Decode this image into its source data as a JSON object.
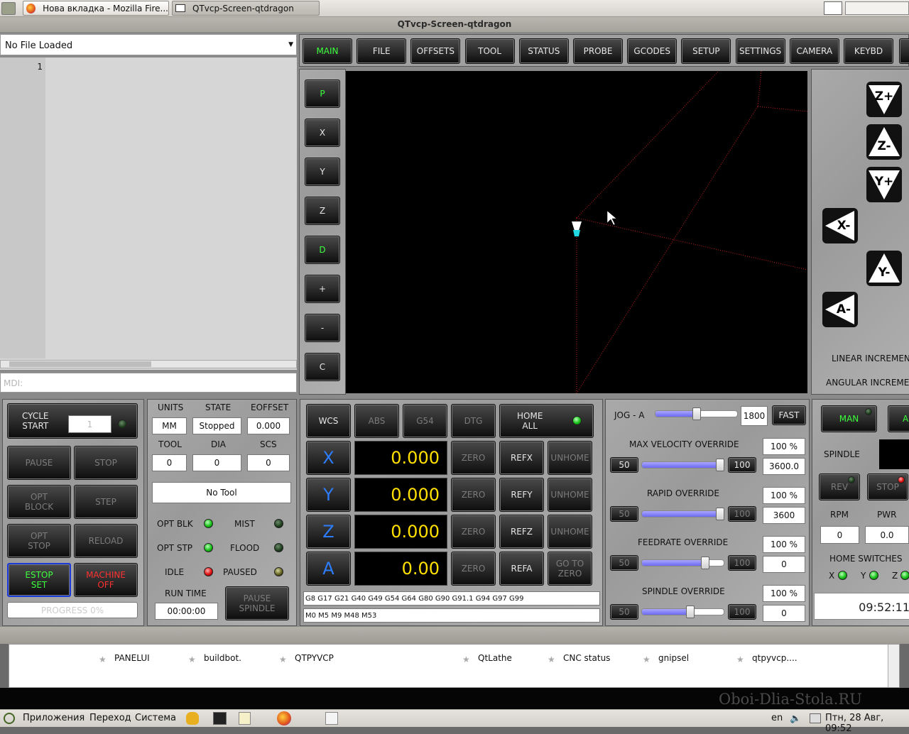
{
  "taskbar": {
    "firefox_tab": "Нова вкладка - Mozilla Fire...",
    "qtvcp_tab": "QTvcp-Screen-qtdragon"
  },
  "window": {
    "title": "QTvcp-Screen-qtdragon"
  },
  "file": {
    "current": "No File Loaded",
    "line_number": "1",
    "mdi_placeholder": "MDI:"
  },
  "tabs": [
    "MAIN",
    "FILE",
    "OFFSETS",
    "TOOL",
    "STATUS",
    "PROBE",
    "GCODES",
    "SETUP",
    "SETTINGS",
    "CAMERA",
    "KEYBD"
  ],
  "view_buttons": [
    "P",
    "X",
    "Y",
    "Z",
    "D",
    "+",
    "-",
    "C"
  ],
  "jog_buttons": [
    "Z+",
    "Z-",
    "Y+",
    "X-",
    "Y-",
    "A-"
  ],
  "increments": {
    "linear": "LINEAR INCREMEN",
    "angular": "ANGULAR INCREMEN"
  },
  "cycle": {
    "cycle_start": "CYCLE\nSTART",
    "cycle_count": "1",
    "pause": "PAUSE",
    "stop": "STOP",
    "opt_block": "OPT\nBLOCK",
    "step": "STEP",
    "opt_stop": "OPT\nSTOP",
    "reload": "RELOAD",
    "estop": "ESTOP\nSET",
    "machine": "MACHINE\nOFF",
    "progress": "PROGRESS 0%"
  },
  "status": {
    "units_label": "UNITS",
    "state_label": "STATE",
    "eoffset_label": "EOFFSET",
    "units": "MM",
    "state": "Stopped",
    "eoffset": "0.000",
    "tool_label": "TOOL",
    "dia_label": "DIA",
    "scs_label": "SCS",
    "tool": "0",
    "dia": "0",
    "scs": "0",
    "tool_desc": "No Tool",
    "opt_blk": "OPT BLK",
    "mist": "MIST",
    "opt_stp": "OPT STP",
    "flood": "FLOOD",
    "idle": "IDLE",
    "paused": "PAUSED",
    "run_time_label": "RUN TIME",
    "run_time": "00:00:00",
    "pause_spindle": "PAUSE\nSPINDLE"
  },
  "dro": {
    "wcs": "WCS",
    "abs": "ABS",
    "g54": "G54",
    "dtg": "DTG",
    "home_all": "HOME\nALL",
    "axes": [
      {
        "name": "X",
        "value": "0.000",
        "zero": "ZERO",
        "ref": "REFX",
        "home": "UNHOME"
      },
      {
        "name": "Y",
        "value": "0.000",
        "zero": "ZERO",
        "ref": "REFY",
        "home": "UNHOME"
      },
      {
        "name": "Z",
        "value": "0.000",
        "zero": "ZERO",
        "ref": "REFZ",
        "home": "UNHOME"
      },
      {
        "name": "A",
        "value": "0.00",
        "zero": "ZERO",
        "ref": "REFA",
        "home": "GO TO\nZERO"
      }
    ],
    "gcodes": "G8 G17 G21 G40 G49 G54 G64 G80 G90 G91.1 G94 G97 G99",
    "mcodes": "M0 M5 M9 M48 M53"
  },
  "overrides": {
    "jog_label": "JOG - A",
    "jog_value": "1800",
    "jog_fast": "FAST",
    "jog_level": 0.5,
    "max_vel": {
      "label": "MAX VELOCITY OVERRIDE",
      "pct": "100 %",
      "value": "3600.0",
      "low": "50",
      "high": "100",
      "level": 1.0
    },
    "rapid": {
      "label": "RAPID OVERRIDE",
      "pct": "100 %",
      "value": "3600",
      "low": "50",
      "high": "100",
      "level": 1.0
    },
    "feed": {
      "label": "FEEDRATE OVERRIDE",
      "pct": "100 %",
      "value": "0",
      "low": "50",
      "high": "100",
      "level": 0.8
    },
    "spindle": {
      "label": "SPINDLE OVERRIDE",
      "pct": "100 %",
      "value": "0",
      "low": "50",
      "high": "100",
      "level": 0.6
    }
  },
  "spindle": {
    "man": "MAN",
    "a": "A",
    "spindle_label": "SPINDLE",
    "rev": "REV",
    "stop": "STOP",
    "rpm_label": "RPM",
    "pwr_label": "PWR",
    "rpm": "0",
    "pwr": "0.0",
    "home_switches": "HOME SWITCHES",
    "x": "X",
    "y": "Y",
    "z": "Z",
    "clock": "09:52:11"
  },
  "bookmarks": [
    "PANELUI",
    "buildbot.",
    "QTPYVCP",
    "QtLathe",
    "CNC status",
    "gnipsel",
    "qtpyvcp...."
  ],
  "bottom": {
    "apps": "Приложения",
    "places": "Переход",
    "system": "Система",
    "lang": "en",
    "datetime": "Птн, 28 Авг, 09:52",
    "watermark": "Oboi-Dlia-Stola.RU"
  }
}
